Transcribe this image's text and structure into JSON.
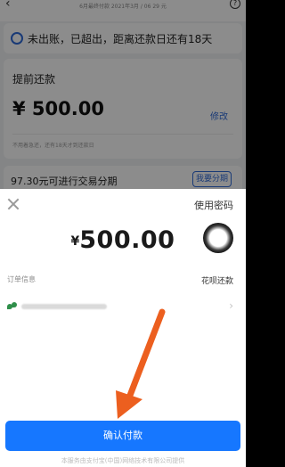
{
  "background_page": {
    "subtitle": "6月最终付款 2021年3月 / 06 29 元",
    "back_icon": "chevron-left-icon",
    "help_icon": "question-icon",
    "status_text": "未出账，已超出，距离还款日还有18天",
    "prepay_title": "提前还款",
    "prepay_amount": "¥ 500.00",
    "edit_label": "修改",
    "prepay_note": "不用着急还，还有18天才到还款日",
    "installment_text": "97.30元可进行交易分期",
    "installment_button": "我要分期"
  },
  "sheet": {
    "close_icon": "close-icon",
    "use_password": "使用密码",
    "currency": "¥",
    "amount": "500.00",
    "touch_icon": "assistive-touch-icon",
    "order_info_label": "订单信息",
    "payment_method": "花呗还款",
    "merchant_icon": "alipay-leaf-icon",
    "merchant_chevron": "chevron-right-icon",
    "confirm_button": "确认付款",
    "footer": "本服务由支付宝(中国)网络技术有限公司提供"
  },
  "colors": {
    "primary": "#1677ff",
    "link": "#2f6ad8",
    "annotation_arrow": "#ec5f1f"
  }
}
